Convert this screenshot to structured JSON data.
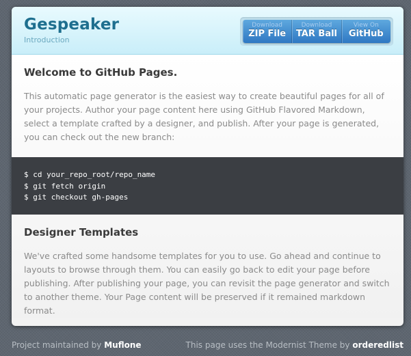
{
  "header": {
    "title": "Gespeaker",
    "subtitle": "Introduction",
    "downloads": [
      {
        "small": "Download",
        "big": "ZIP File"
      },
      {
        "small": "Download",
        "big": "TAR Ball"
      },
      {
        "small": "View On",
        "big": "GitHub"
      }
    ]
  },
  "section1": {
    "heading": "Welcome to GitHub Pages.",
    "body": "This automatic page generator is the easiest way to create beautiful pages for all of your projects. Author your page content here using GitHub Flavored Markdown, select a template crafted by a designer, and publish. After your page is generated, you can check out the new branch:"
  },
  "code": {
    "lines": [
      "$ cd your_repo_root/repo_name",
      "$ git fetch origin",
      "$ git checkout gh-pages"
    ]
  },
  "section2": {
    "heading": "Designer Templates",
    "body": "We've crafted some handsome templates for you to use. Go ahead and continue to layouts to browse through them. You can easily go back to edit your page before publishing. After publishing your page, you can revisit the page generator and switch to another theme. Your Page content will be preserved if it remained markdown format."
  },
  "footer": {
    "left_prefix": "Project maintained by",
    "left_link": "Muflone",
    "right_prefix": "This page uses the Modernist Theme by",
    "right_link": "orderedlist"
  },
  "colors": {
    "background": "#5e6670",
    "title": "#1e6f8f",
    "button": "#2f78c3",
    "code_bg": "#3b3e43"
  }
}
